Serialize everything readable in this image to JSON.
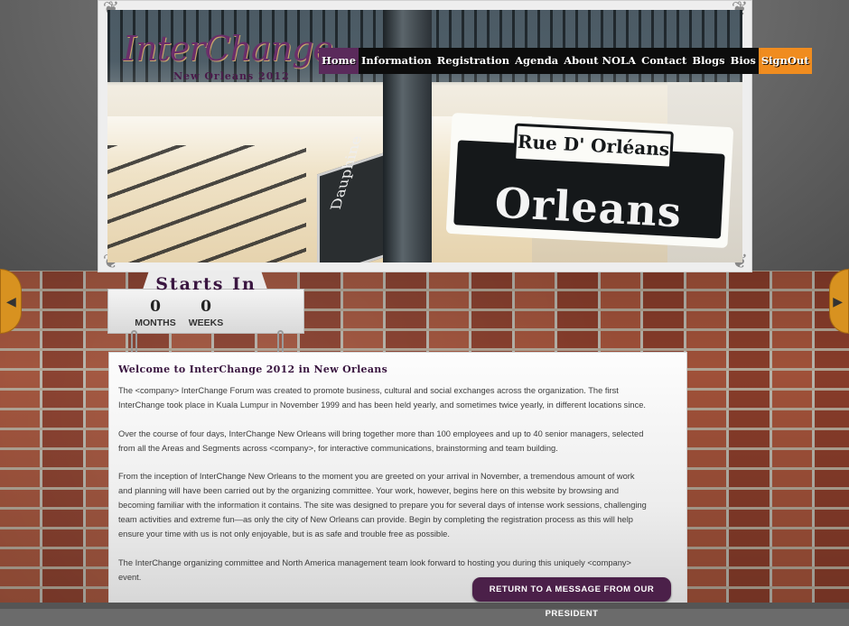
{
  "logo": {
    "script": "InterChange",
    "subtitle": "New Orleans 2012"
  },
  "nav": {
    "items": [
      "Home",
      "Information",
      "Registration",
      "Agenda",
      "About NOLA",
      "Contact",
      "Blogs",
      "Bios",
      "SignOut"
    ],
    "active": "Home"
  },
  "hero": {
    "sign_top": "Rue D' Orléans",
    "sign_main": "Orleans",
    "sign_side": "Dauphine"
  },
  "countdown": {
    "title": "Starts In",
    "months_value": "0",
    "months_label": "MONTHS",
    "weeks_value": "0",
    "weeks_label": "WEEKS"
  },
  "content": {
    "heading": "Welcome to InterChange 2012 in New Orleans",
    "paragraphs": [
      "The <company> InterChange Forum was created to promote business, cultural and social exchanges across the organization. The first InterChange took place in Kuala Lumpur in November 1999 and has been held yearly, and sometimes twice yearly, in different locations since.",
      "Over the course of four days, InterChange New Orleans will bring together more than 100 employees and up to 40 senior managers, selected from all the Areas and Segments across <company>, for interactive communications, brainstorming and team building.",
      "From the inception of InterChange New Orleans to the moment you are greeted on your arrival in November, a tremendous amount of work and planning will have been carried out by the organizing committee. Your work, however, begins here on this website by browsing and becoming familiar with the information it contains. The site was designed to prepare you for several days of intense work sessions, challenging team activities and extreme fun—as only the city of New Orleans can provide. Begin by completing the registration process as this will help ensure your time with us is not only enjoyable, but is as safe and trouble free as possible.",
      "The InterChange organizing committee and North America management team look forward to hosting you during this uniquely <company> event."
    ],
    "cta_label": "RETURN TO A MESSAGE FROM OUR PRESIDENT"
  },
  "colors": {
    "accent": "#4b2049",
    "signout": "#f08c1f",
    "nav_active": "#5a2a5b"
  },
  "icons": {
    "left_arrow": "chevron-left-icon",
    "right_arrow": "chevron-right-icon"
  }
}
